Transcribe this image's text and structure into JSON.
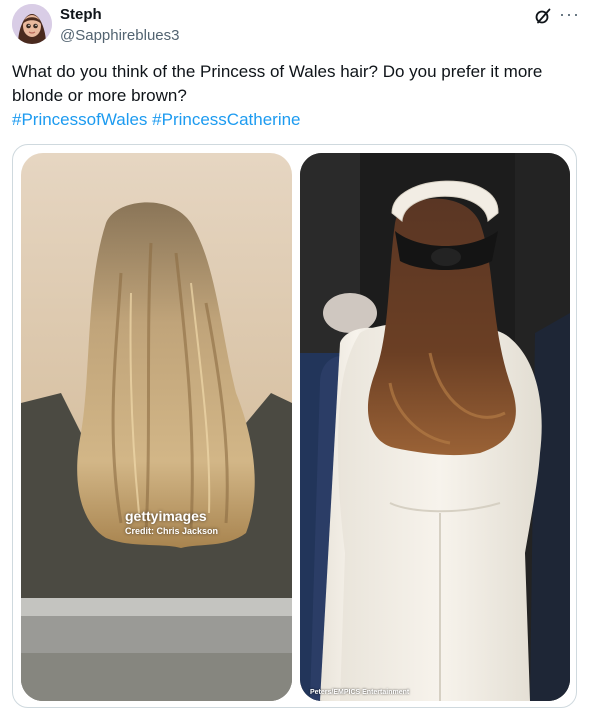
{
  "author": {
    "name": "Steph",
    "handle": "@Sapphireblues3"
  },
  "post": {
    "text": "What do you think of the Princess of Wales hair? Do you prefer it more blonde or more brown?",
    "hashtags": [
      "#PrincessofWales",
      "#PrincessCatherine"
    ]
  },
  "media": {
    "left_watermark": "gettyimages",
    "left_credit": "Credit: Chris Jackson",
    "right_credit": "Peters/EMPICS Entertainment"
  },
  "icons": {
    "header_action": "grok-icon",
    "more": "more-options-icon"
  },
  "colors": {
    "link": "#1d9bf0",
    "secondary_text": "#536471",
    "border": "#cfd9de"
  }
}
